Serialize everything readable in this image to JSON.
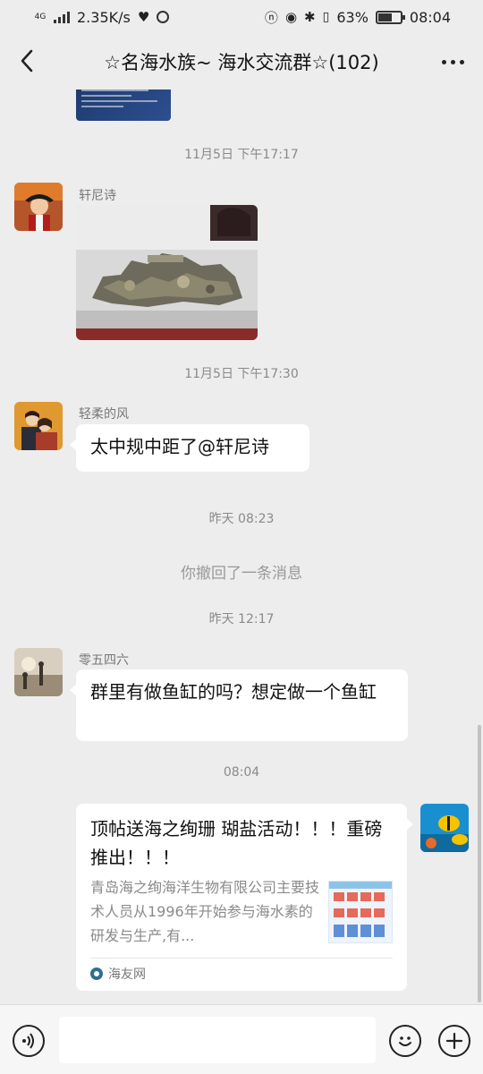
{
  "status_bar": {
    "network_type": "4G",
    "speed": "2.35K/s",
    "battery": "63%",
    "time": "08:04"
  },
  "nav": {
    "title": "☆名海水族~ 海水交流群☆(102)"
  },
  "messages": [
    {
      "type": "time",
      "text": "11月5日 下午17:17"
    },
    {
      "type": "image",
      "sender": "轩尼诗"
    },
    {
      "type": "time",
      "text": "11月5日 下午17:30"
    },
    {
      "type": "text",
      "sender": "轻柔的风",
      "text": "太中规中距了@轩尼诗"
    },
    {
      "type": "time",
      "text": "昨天 08:23"
    },
    {
      "type": "system",
      "text": "你撤回了一条消息"
    },
    {
      "type": "time",
      "text": "昨天 12:17"
    },
    {
      "type": "text",
      "sender": "零五四六",
      "text": "群里有做鱼缸的吗？想定做一个鱼缸"
    },
    {
      "type": "time",
      "text": "08:04"
    },
    {
      "type": "link",
      "title": "顶帖送海之绚珊 瑚盐活动！！！重磅推出！！！",
      "description": "青岛海之绚海洋生物有限公司主要技术人员从1996年开始参与海水素的研发与生产,有...",
      "source": "海友网"
    }
  ],
  "icons": {
    "back": "back-arrow-icon",
    "more": "more-dots-icon",
    "voice": "voice-icon",
    "emoji": "emoji-icon",
    "plus": "plus-icon"
  }
}
